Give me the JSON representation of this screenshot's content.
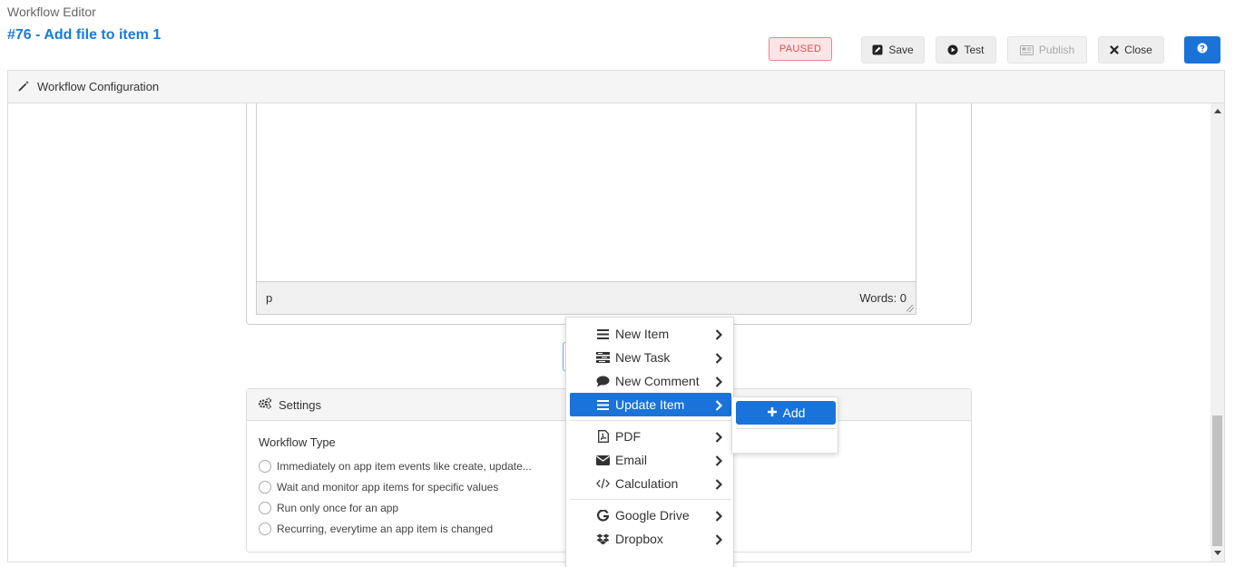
{
  "header": {
    "breadcrumb": "Workflow Editor",
    "title": "#76 - Add file to item 1",
    "status": "PAUSED",
    "buttons": {
      "save": "Save",
      "test": "Test",
      "publish": "Publish",
      "close": "Close"
    }
  },
  "panel": {
    "title": "Workflow Configuration"
  },
  "editor": {
    "path": "p",
    "word_count": "Words: 0"
  },
  "settings": {
    "title": "Settings",
    "workflow_type_label": "Workflow Type",
    "options": [
      "Immediately on app item events like create, update...",
      "Wait and monitor app items for specific values",
      "Run only once for an app",
      "Recurring, everytime an app item is changed"
    ]
  },
  "menu": {
    "items": [
      {
        "label": "New Item",
        "icon": "list-icon"
      },
      {
        "label": "New Task",
        "icon": "tasks-icon"
      },
      {
        "label": "New Comment",
        "icon": "comment-icon"
      },
      {
        "label": "Update Item",
        "icon": "list-icon"
      },
      {
        "label": "PDF",
        "icon": "pdf-icon"
      },
      {
        "label": "Email",
        "icon": "envelope-icon"
      },
      {
        "label": "Calculation",
        "icon": "code-icon"
      },
      {
        "label": "Google Drive",
        "icon": "google-icon"
      },
      {
        "label": "Dropbox",
        "icon": "dropbox-icon"
      }
    ],
    "submenu": {
      "add": "Add"
    }
  },
  "colors": {
    "accent": "#1a73d9",
    "title": "#1a7ad4",
    "paused_bg": "#fde4e6",
    "paused_text": "#d9534f"
  }
}
